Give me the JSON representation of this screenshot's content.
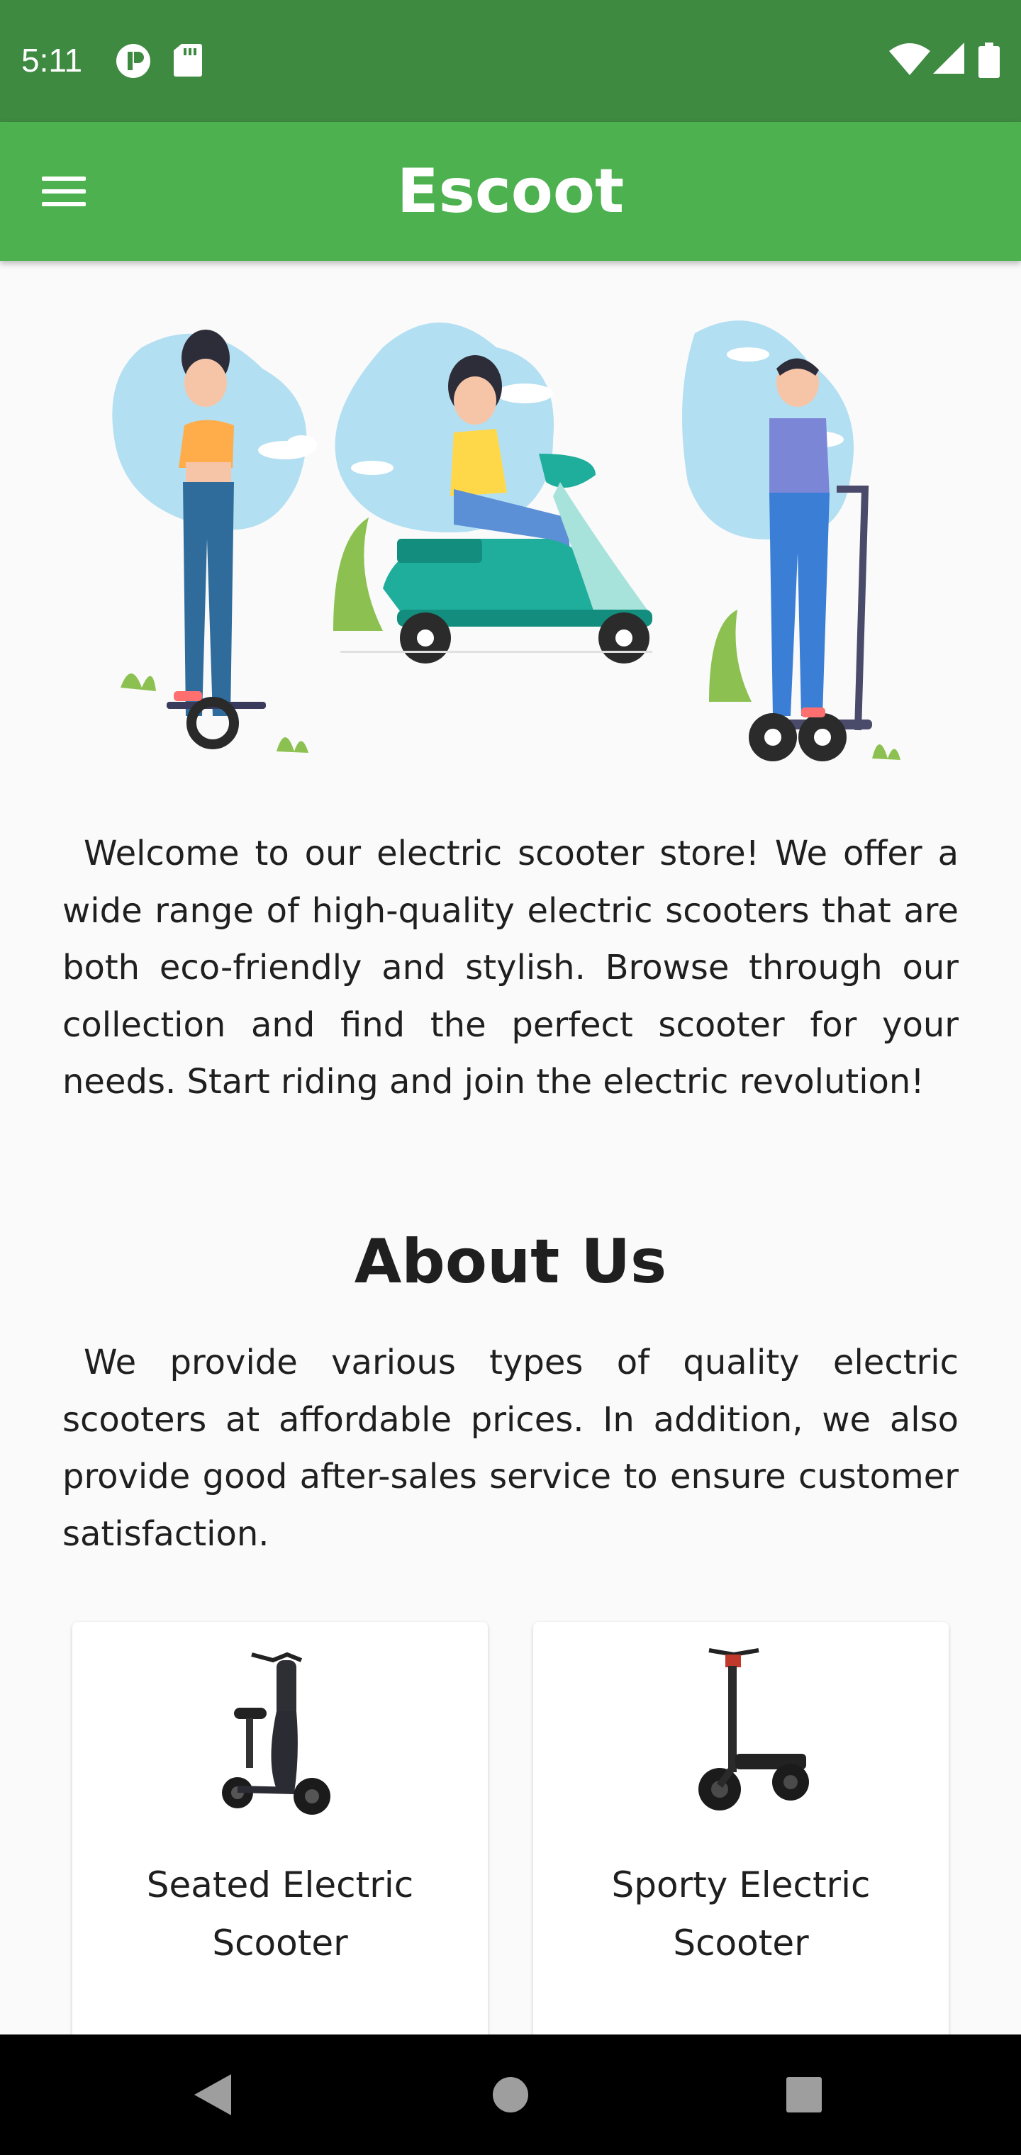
{
  "status_bar": {
    "time": "5:11",
    "icons": [
      "media-circle-icon",
      "sd-card-icon",
      "wifi-icon",
      "cell-signal-icon",
      "battery-icon"
    ]
  },
  "app_bar": {
    "title": "Escoot",
    "menu_icon": "hamburger-menu-icon"
  },
  "hero": {
    "illustration": "people-riding-electric-scooters-illustration"
  },
  "welcome": {
    "text": "Welcome to our electric scooter store! We offer a wide range of high-quality electric scooters that are both eco-friendly and stylish. Browse through our collection and find the perfect scooter for your needs. Start riding and join the electric revolution!"
  },
  "about": {
    "heading": "About Us",
    "text": "We provide various types of quality electric scooters at affordable prices. In addition, we also provide good after-sales service to ensure customer satisfaction."
  },
  "products": [
    {
      "name": "Seated Electric Scooter",
      "image": "seated-scooter-image"
    },
    {
      "name": "Sporty Electric Scooter",
      "image": "sporty-scooter-image"
    }
  ],
  "nav_bar": {
    "icons": [
      "back-icon",
      "home-icon",
      "recents-icon"
    ]
  },
  "colors": {
    "status_bar": "#3e8a41",
    "app_bar": "#4db150",
    "background": "#fafafa",
    "scooter_teal": "#14ad9b",
    "blob_blue": "#b3dff2"
  }
}
